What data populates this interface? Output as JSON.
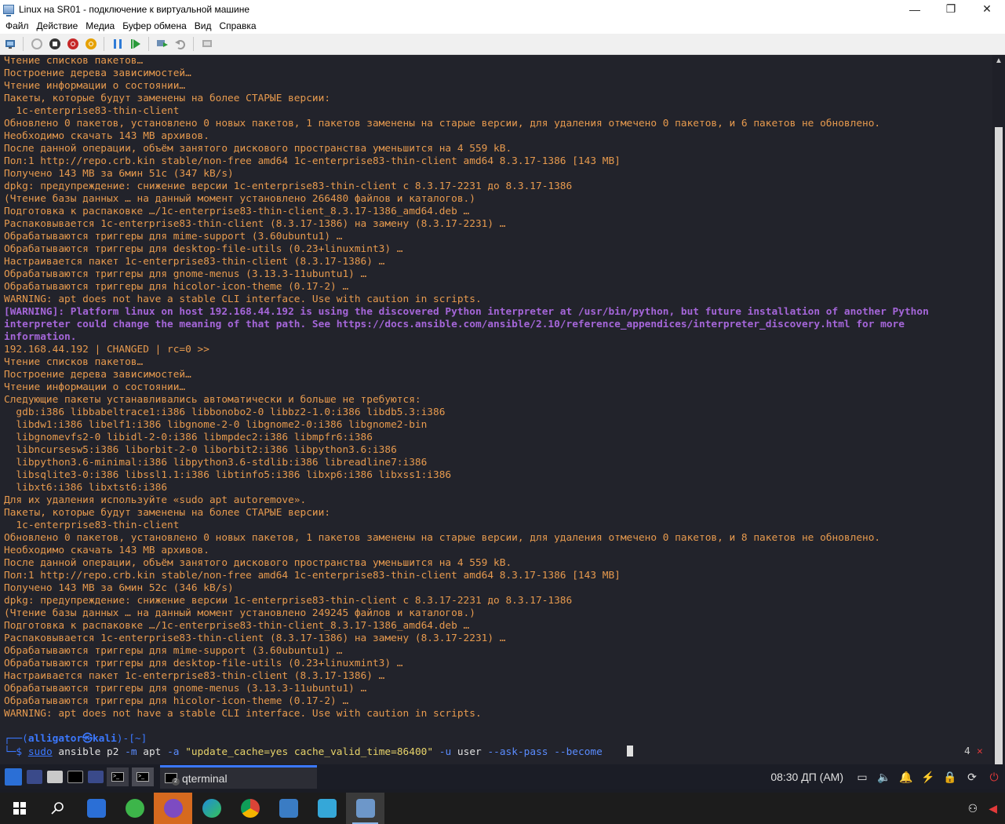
{
  "window": {
    "title": "Linux на SR01 - подключение к виртуальной машине",
    "minimize": "—",
    "restore": "❐",
    "close": "✕"
  },
  "menu": {
    "items": [
      "Файл",
      "Действие",
      "Медиа",
      "Буфер обмена",
      "Вид",
      "Справка"
    ]
  },
  "terminal": {
    "lines": [
      {
        "t": "Чтение списков пакетов…",
        "c": ""
      },
      {
        "t": "Построение дерева зависимостей…",
        "c": ""
      },
      {
        "t": "Чтение информации о состоянии…",
        "c": ""
      },
      {
        "t": "Пакеты, которые будут заменены на более СТАРЫЕ версии:",
        "c": ""
      },
      {
        "t": "  1c-enterprise83-thin-client",
        "c": ""
      },
      {
        "t": "Обновлено 0 пакетов, установлено 0 новых пакетов, 1 пакетов заменены на старые версии, для удаления отмечено 0 пакетов, и 6 пакетов не обновлено.",
        "c": ""
      },
      {
        "t": "Необходимо скачать 143 MB архивов.",
        "c": ""
      },
      {
        "t": "После данной операции, объём занятого дискового пространства уменьшится на 4 559 kB.",
        "c": ""
      },
      {
        "t": "Пол:1 http://repo.crb.kin stable/non-free amd64 1c-enterprise83-thin-client amd64 8.3.17-1386 [143 MB]",
        "c": ""
      },
      {
        "t": "Получено 143 MB за 6мин 51c (347 kB/s)",
        "c": ""
      },
      {
        "t": "dpkg: предупреждение: снижение версии 1c-enterprise83-thin-client с 8.3.17-2231 до 8.3.17-1386",
        "c": ""
      },
      {
        "t": "(Чтение базы данных … на данный момент установлено 266480 файлов и каталогов.)",
        "c": ""
      },
      {
        "t": "Подготовка к распаковке …/1c-enterprise83-thin-client_8.3.17-1386_amd64.deb …",
        "c": ""
      },
      {
        "t": "Распаковывается 1c-enterprise83-thin-client (8.3.17-1386) на замену (8.3.17-2231) …",
        "c": ""
      },
      {
        "t": "Обрабатываются триггеры для mime-support (3.60ubuntu1) …",
        "c": ""
      },
      {
        "t": "Обрабатываются триггеры для desktop-file-utils (0.23+linuxmint3) …",
        "c": ""
      },
      {
        "t": "Настраивается пакет 1c-enterprise83-thin-client (8.3.17-1386) …",
        "c": ""
      },
      {
        "t": "Обрабатываются триггеры для gnome-menus (3.13.3-11ubuntu1) …",
        "c": ""
      },
      {
        "t": "Обрабатываются триггеры для hicolor-icon-theme (0.17-2) …",
        "c": ""
      },
      {
        "t": "WARNING: apt does not have a stable CLI interface. Use with caution in scripts.",
        "c": ""
      },
      {
        "t": "[WARNING]: Platform linux on host 192.168.44.192 is using the discovered Python interpreter at /usr/bin/python, but future installation of another Python",
        "c": "warn"
      },
      {
        "t": "interpreter could change the meaning of that path. See https://docs.ansible.com/ansible/2.10/reference_appendices/interpreter_discovery.html for more",
        "c": "warn"
      },
      {
        "t": "information.",
        "c": "warn"
      },
      {
        "t": "192.168.44.192 | CHANGED | rc=0 >>",
        "c": "changed"
      },
      {
        "t": "Чтение списков пакетов…",
        "c": ""
      },
      {
        "t": "Построение дерева зависимостей…",
        "c": ""
      },
      {
        "t": "Чтение информации о состоянии…",
        "c": ""
      },
      {
        "t": "Следующие пакеты устанавливались автоматически и больше не требуются:",
        "c": ""
      },
      {
        "t": "  gdb:i386 libbabeltrace1:i386 libbonobo2-0 libbz2-1.0:i386 libdb5.3:i386",
        "c": ""
      },
      {
        "t": "  libdw1:i386 libelf1:i386 libgnome-2-0 libgnome2-0:i386 libgnome2-bin",
        "c": ""
      },
      {
        "t": "  libgnomevfs2-0 libidl-2-0:i386 libmpdec2:i386 libmpfr6:i386",
        "c": ""
      },
      {
        "t": "  libncursesw5:i386 liborbit-2-0 liborbit2:i386 libpython3.6:i386",
        "c": ""
      },
      {
        "t": "  libpython3.6-minimal:i386 libpython3.6-stdlib:i386 libreadline7:i386",
        "c": ""
      },
      {
        "t": "  libsqlite3-0:i386 libssl1.1:i386 libtinfo5:i386 libxp6:i386 libxss1:i386",
        "c": ""
      },
      {
        "t": "  libxt6:i386 libxtst6:i386",
        "c": ""
      },
      {
        "t": "Для их удаления используйте «sudo apt autoremove».",
        "c": ""
      },
      {
        "t": "Пакеты, которые будут заменены на более СТАРЫЕ версии:",
        "c": ""
      },
      {
        "t": "  1c-enterprise83-thin-client",
        "c": ""
      },
      {
        "t": "Обновлено 0 пакетов, установлено 0 новых пакетов, 1 пакетов заменены на старые версии, для удаления отмечено 0 пакетов, и 8 пакетов не обновлено.",
        "c": ""
      },
      {
        "t": "Необходимо скачать 143 MB архивов.",
        "c": ""
      },
      {
        "t": "После данной операции, объём занятого дискового пространства уменьшится на 4 559 kB.",
        "c": ""
      },
      {
        "t": "Пол:1 http://repo.crb.kin stable/non-free amd64 1c-enterprise83-thin-client amd64 8.3.17-1386 [143 MB]",
        "c": ""
      },
      {
        "t": "Получено 143 MB за 6мин 52c (346 kB/s)",
        "c": ""
      },
      {
        "t": "dpkg: предупреждение: снижение версии 1c-enterprise83-thin-client с 8.3.17-2231 до 8.3.17-1386",
        "c": ""
      },
      {
        "t": "(Чтение базы данных … на данный момент установлено 249245 файлов и каталогов.)",
        "c": ""
      },
      {
        "t": "Подготовка к распаковке …/1c-enterprise83-thin-client_8.3.17-1386_amd64.deb …",
        "c": ""
      },
      {
        "t": "Распаковывается 1c-enterprise83-thin-client (8.3.17-1386) на замену (8.3.17-2231) …",
        "c": ""
      },
      {
        "t": "Обрабатываются триггеры для mime-support (3.60ubuntu1) …",
        "c": ""
      },
      {
        "t": "Обрабатываются триггеры для desktop-file-utils (0.23+linuxmint3) …",
        "c": ""
      },
      {
        "t": "Настраивается пакет 1c-enterprise83-thin-client (8.3.17-1386) …",
        "c": ""
      },
      {
        "t": "Обрабатываются триггеры для gnome-menus (3.13.3-11ubuntu1) …",
        "c": ""
      },
      {
        "t": "Обрабатываются триггеры для hicolor-icon-theme (0.17-2) …",
        "c": ""
      },
      {
        "t": "WARNING: apt does not have a stable CLI interface. Use with caution in scripts.",
        "c": ""
      }
    ],
    "prompt": {
      "corner_top": "┌──(",
      "user": "alligator㉿kali",
      "dir": ")-[~]",
      "corner_bottom": "└─$ ",
      "cmd_sudo": "sudo",
      "cmd_rest1": " ansible p2 ",
      "cmd_opt_m": "-m",
      "cmd_rest2": " apt ",
      "cmd_opt_a": "-a",
      "cmd_str": " \"update_cache=yes cache_valid_time=86400\" ",
      "cmd_opt_u": "-u",
      "cmd_rest3": " user ",
      "cmd_opt_ask": "--ask-pass",
      "cmd_opt_become": " --become",
      "job_count": "4",
      "job_status": "✕"
    }
  },
  "guest_taskbar": {
    "task_label": "qterminal",
    "task_badge": "2",
    "clock": "08:30 ДП (AM)"
  },
  "colors": {
    "terminal_bg": "#22232b",
    "terminal_text": "#e79a4e",
    "warning_text": "#a566d9",
    "prompt_blue": "#3b78ff"
  }
}
